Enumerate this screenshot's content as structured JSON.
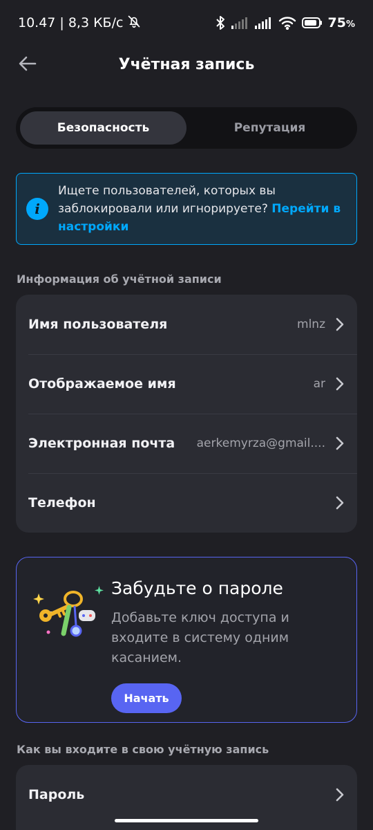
{
  "status_bar": {
    "time": "10.47",
    "separator": "|",
    "speed": "8,3 КБ/с",
    "battery_level": "75",
    "battery_percent_sign": "%"
  },
  "header": {
    "title": "Учётная запись"
  },
  "tabs": [
    {
      "label": "Безопасность",
      "active": true
    },
    {
      "label": "Репутация",
      "active": false
    }
  ],
  "info_banner": {
    "text": "Ищете пользователей, которых вы заблокировали или игнорируете?",
    "link": "Перейти в настройки"
  },
  "account_info": {
    "section_title": "Информация об учётной записи",
    "rows": [
      {
        "label": "Имя пользователя",
        "value": "mlnz"
      },
      {
        "label": "Отображаемое имя",
        "value": "ar"
      },
      {
        "label": "Электронная почта",
        "value": "aerkemyrza@gmail...."
      },
      {
        "label": "Телефон",
        "value": ""
      }
    ]
  },
  "passkey_promo": {
    "title": "Забудьте о пароле",
    "description": "Добавьте ключ доступа и входите в систему одним касанием.",
    "button_label": "Начать"
  },
  "login_section": {
    "section_title": "Как вы входите в свою учётную запись",
    "rows": [
      {
        "label": "Пароль"
      }
    ]
  },
  "colors": {
    "background": "#1f1f24",
    "card": "#2b2c33",
    "accent_blue": "#00a8fc",
    "brand": "#5865f2"
  },
  "icons": {
    "back": "arrow-left-icon",
    "info": "info-icon",
    "chevron": "chevron-right-icon"
  }
}
